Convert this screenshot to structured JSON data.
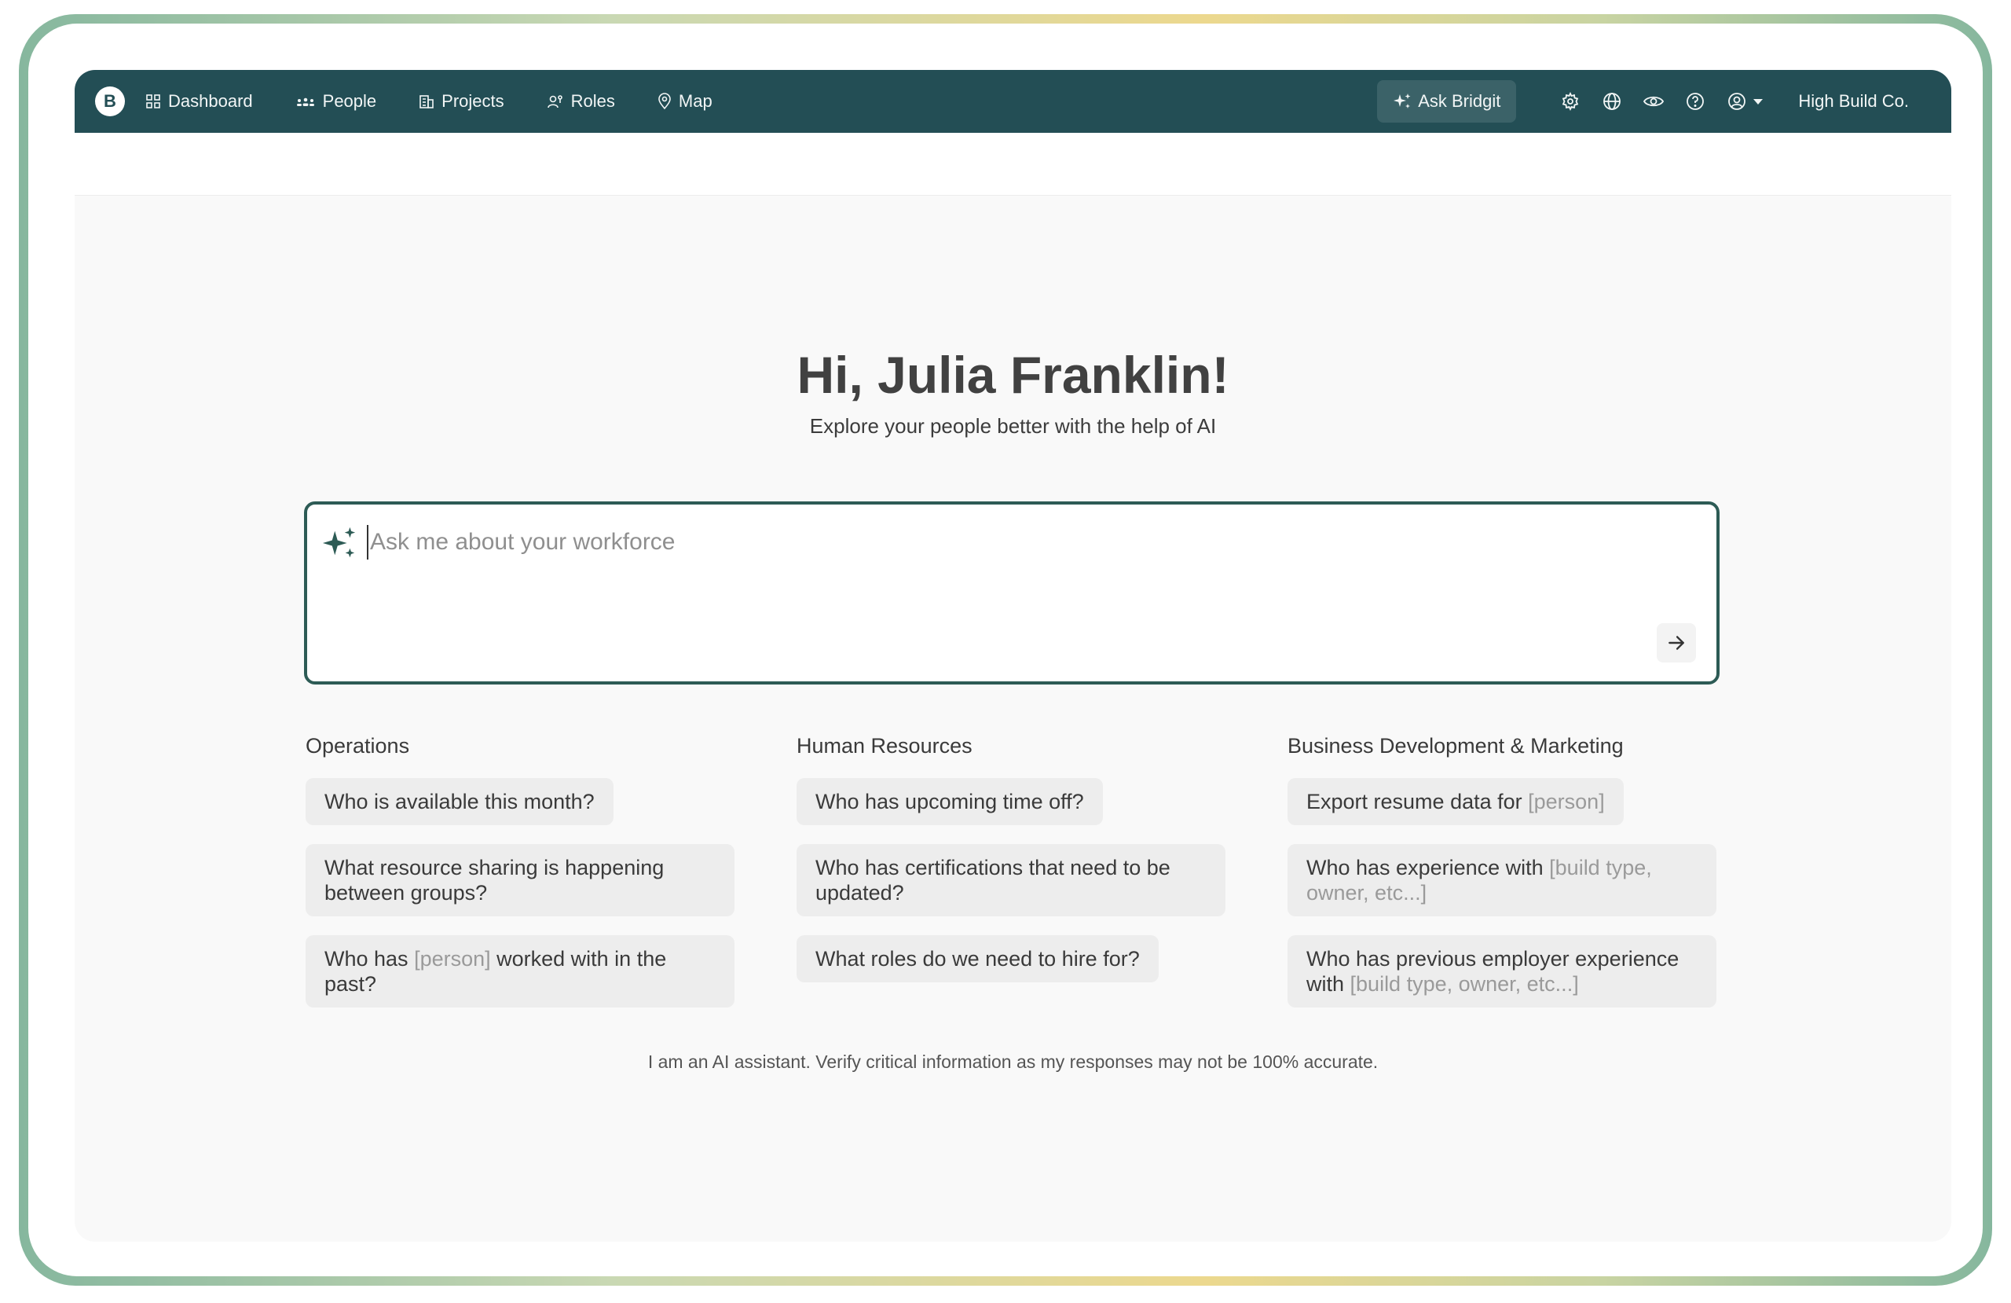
{
  "nav": {
    "logo": "B",
    "items": [
      {
        "label": "Dashboard",
        "icon": "grid-icon"
      },
      {
        "label": "People",
        "icon": "people-icon"
      },
      {
        "label": "Projects",
        "icon": "building-icon"
      },
      {
        "label": "Roles",
        "icon": "user-key-icon"
      },
      {
        "label": "Map",
        "icon": "map-pin-icon"
      }
    ],
    "ask_label": "Ask Bridgit",
    "company": "High Build Co."
  },
  "main": {
    "greeting": "Hi, Julia Franklin!",
    "subtitle": "Explore your people better with the help of AI",
    "prompt_placeholder": "Ask me about your workforce",
    "disclaimer": "I am an AI assistant. Verify critical information as my responses may not be 100% accurate."
  },
  "categories": [
    {
      "title": "Operations",
      "prompts": [
        {
          "parts": [
            {
              "t": "Who is available this month?"
            }
          ]
        },
        {
          "parts": [
            {
              "t": "What resource sharing is happening between groups?"
            }
          ]
        },
        {
          "parts": [
            {
              "t": "Who has "
            },
            {
              "t": "[person]",
              "ph": true
            },
            {
              "t": " worked with in the past?"
            }
          ]
        }
      ]
    },
    {
      "title": "Human Resources",
      "prompts": [
        {
          "parts": [
            {
              "t": "Who has upcoming time off?"
            }
          ]
        },
        {
          "parts": [
            {
              "t": "Who has certifications that need to be updated?"
            }
          ]
        },
        {
          "parts": [
            {
              "t": "What roles do we need to hire for?"
            }
          ]
        }
      ]
    },
    {
      "title": "Business Development & Marketing",
      "prompts": [
        {
          "parts": [
            {
              "t": "Export resume data for "
            },
            {
              "t": "[person]",
              "ph": true
            }
          ]
        },
        {
          "parts": [
            {
              "t": "Who has experience with "
            },
            {
              "t": "[build type, owner, etc...]",
              "ph": true
            }
          ]
        },
        {
          "parts": [
            {
              "t": "Who has previous employer experience with "
            },
            {
              "t": "[build type, owner, etc...]",
              "ph": true
            }
          ]
        }
      ]
    }
  ],
  "colors": {
    "nav_bg": "#234e55",
    "accent": "#2d5b55",
    "chip_bg": "#ededed"
  }
}
